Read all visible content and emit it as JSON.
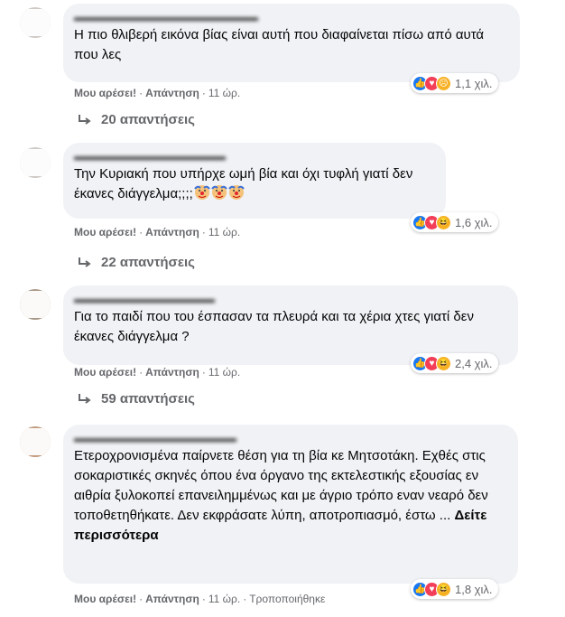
{
  "comments": [
    {
      "text": "Η πιο θλιβερή εικόνα βίας είναι αυτή που διαφαίνεται πίσω από αυτά που λες",
      "reactions": {
        "icons": [
          "like-icon",
          "love-icon",
          "sad-icon"
        ],
        "count": "1,1 χιλ."
      },
      "actions": {
        "like": "Μου αρέσει!",
        "reply": "Απάντηση",
        "time": "11 ώρ."
      },
      "replies": "20 απαντήσεις"
    },
    {
      "text": "Την Κυριακή που υπήρχε ωμή βία και όχι τυφλή γιατί δεν έκανες διάγγελμα;;;;",
      "emoji": [
        "clown-icon",
        "clown-icon",
        "clown-icon"
      ],
      "reactions": {
        "icons": [
          "like-icon",
          "love-icon",
          "haha-icon"
        ],
        "count": "1,6 χιλ."
      },
      "actions": {
        "like": "Μου αρέσει!",
        "reply": "Απάντηση",
        "time": "11 ώρ."
      },
      "replies": "22 απαντήσεις"
    },
    {
      "text": "Για το παιδί που του έσπασαν τα πλευρά και τα χέρια χτες γιατί δεν έκανες διάγγελμα ?",
      "reactions": {
        "icons": [
          "like-icon",
          "love-icon",
          "haha-icon"
        ],
        "count": "2,4 χιλ."
      },
      "actions": {
        "like": "Μου αρέσει!",
        "reply": "Απάντηση",
        "time": "11 ώρ."
      },
      "replies": "59 απαντήσεις"
    },
    {
      "text": "Ετεροχρονισμένα παίρνετε θέση για τη βία κε Μητσοτάκη. Εχθές στις σοκαριστικές σκηνές όπου ένα όργανο της εκτελεστικής εξουσίας εν αιθρία ξυλοκοπεί επανειλημμένως και με άγριο τρόπο εναν νεαρό δεν τοποθετηθήκατε. Δεν εκφράσατε λύπη, αποτροπιασμό, έστω ...",
      "see_more": "Δείτε περισσότερα",
      "reactions": {
        "icons": [
          "like-icon",
          "love-icon",
          "haha-icon"
        ],
        "count": "1,8 χιλ."
      },
      "actions": {
        "like": "Μου αρέσει!",
        "reply": "Απάντηση",
        "time": "11 ώρ.",
        "edited": "Τροποποιήθηκε"
      }
    }
  ],
  "colors": {
    "like": "#1877f2",
    "love": "#f33e58",
    "yellow": "#f7b125",
    "bubble": "#f0f2f5",
    "meta": "#65676b"
  }
}
